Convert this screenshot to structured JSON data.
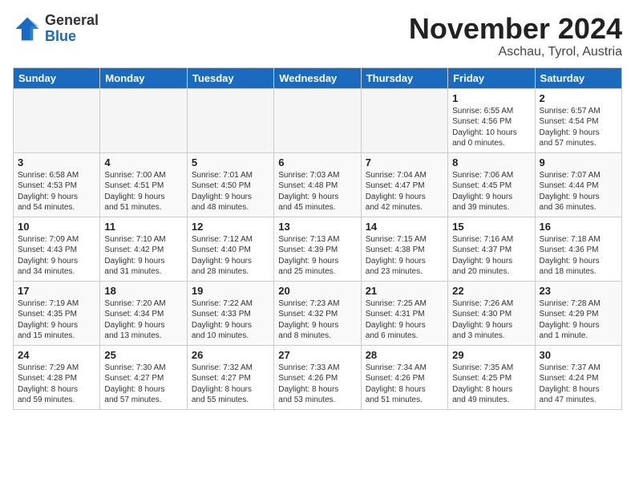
{
  "logo": {
    "general": "General",
    "blue": "Blue"
  },
  "header": {
    "month": "November 2024",
    "location": "Aschau, Tyrol, Austria"
  },
  "weekdays": [
    "Sunday",
    "Monday",
    "Tuesday",
    "Wednesday",
    "Thursday",
    "Friday",
    "Saturday"
  ],
  "weeks": [
    [
      {
        "day": "",
        "info": ""
      },
      {
        "day": "",
        "info": ""
      },
      {
        "day": "",
        "info": ""
      },
      {
        "day": "",
        "info": ""
      },
      {
        "day": "",
        "info": ""
      },
      {
        "day": "1",
        "info": "Sunrise: 6:55 AM\nSunset: 4:56 PM\nDaylight: 10 hours\nand 0 minutes."
      },
      {
        "day": "2",
        "info": "Sunrise: 6:57 AM\nSunset: 4:54 PM\nDaylight: 9 hours\nand 57 minutes."
      }
    ],
    [
      {
        "day": "3",
        "info": "Sunrise: 6:58 AM\nSunset: 4:53 PM\nDaylight: 9 hours\nand 54 minutes."
      },
      {
        "day": "4",
        "info": "Sunrise: 7:00 AM\nSunset: 4:51 PM\nDaylight: 9 hours\nand 51 minutes."
      },
      {
        "day": "5",
        "info": "Sunrise: 7:01 AM\nSunset: 4:50 PM\nDaylight: 9 hours\nand 48 minutes."
      },
      {
        "day": "6",
        "info": "Sunrise: 7:03 AM\nSunset: 4:48 PM\nDaylight: 9 hours\nand 45 minutes."
      },
      {
        "day": "7",
        "info": "Sunrise: 7:04 AM\nSunset: 4:47 PM\nDaylight: 9 hours\nand 42 minutes."
      },
      {
        "day": "8",
        "info": "Sunrise: 7:06 AM\nSunset: 4:45 PM\nDaylight: 9 hours\nand 39 minutes."
      },
      {
        "day": "9",
        "info": "Sunrise: 7:07 AM\nSunset: 4:44 PM\nDaylight: 9 hours\nand 36 minutes."
      }
    ],
    [
      {
        "day": "10",
        "info": "Sunrise: 7:09 AM\nSunset: 4:43 PM\nDaylight: 9 hours\nand 34 minutes."
      },
      {
        "day": "11",
        "info": "Sunrise: 7:10 AM\nSunset: 4:42 PM\nDaylight: 9 hours\nand 31 minutes."
      },
      {
        "day": "12",
        "info": "Sunrise: 7:12 AM\nSunset: 4:40 PM\nDaylight: 9 hours\nand 28 minutes."
      },
      {
        "day": "13",
        "info": "Sunrise: 7:13 AM\nSunset: 4:39 PM\nDaylight: 9 hours\nand 25 minutes."
      },
      {
        "day": "14",
        "info": "Sunrise: 7:15 AM\nSunset: 4:38 PM\nDaylight: 9 hours\nand 23 minutes."
      },
      {
        "day": "15",
        "info": "Sunrise: 7:16 AM\nSunset: 4:37 PM\nDaylight: 9 hours\nand 20 minutes."
      },
      {
        "day": "16",
        "info": "Sunrise: 7:18 AM\nSunset: 4:36 PM\nDaylight: 9 hours\nand 18 minutes."
      }
    ],
    [
      {
        "day": "17",
        "info": "Sunrise: 7:19 AM\nSunset: 4:35 PM\nDaylight: 9 hours\nand 15 minutes."
      },
      {
        "day": "18",
        "info": "Sunrise: 7:20 AM\nSunset: 4:34 PM\nDaylight: 9 hours\nand 13 minutes."
      },
      {
        "day": "19",
        "info": "Sunrise: 7:22 AM\nSunset: 4:33 PM\nDaylight: 9 hours\nand 10 minutes."
      },
      {
        "day": "20",
        "info": "Sunrise: 7:23 AM\nSunset: 4:32 PM\nDaylight: 9 hours\nand 8 minutes."
      },
      {
        "day": "21",
        "info": "Sunrise: 7:25 AM\nSunset: 4:31 PM\nDaylight: 9 hours\nand 6 minutes."
      },
      {
        "day": "22",
        "info": "Sunrise: 7:26 AM\nSunset: 4:30 PM\nDaylight: 9 hours\nand 3 minutes."
      },
      {
        "day": "23",
        "info": "Sunrise: 7:28 AM\nSunset: 4:29 PM\nDaylight: 9 hours\nand 1 minute."
      }
    ],
    [
      {
        "day": "24",
        "info": "Sunrise: 7:29 AM\nSunset: 4:28 PM\nDaylight: 8 hours\nand 59 minutes."
      },
      {
        "day": "25",
        "info": "Sunrise: 7:30 AM\nSunset: 4:27 PM\nDaylight: 8 hours\nand 57 minutes."
      },
      {
        "day": "26",
        "info": "Sunrise: 7:32 AM\nSunset: 4:27 PM\nDaylight: 8 hours\nand 55 minutes."
      },
      {
        "day": "27",
        "info": "Sunrise: 7:33 AM\nSunset: 4:26 PM\nDaylight: 8 hours\nand 53 minutes."
      },
      {
        "day": "28",
        "info": "Sunrise: 7:34 AM\nSunset: 4:26 PM\nDaylight: 8 hours\nand 51 minutes."
      },
      {
        "day": "29",
        "info": "Sunrise: 7:35 AM\nSunset: 4:25 PM\nDaylight: 8 hours\nand 49 minutes."
      },
      {
        "day": "30",
        "info": "Sunrise: 7:37 AM\nSunset: 4:24 PM\nDaylight: 8 hours\nand 47 minutes."
      }
    ]
  ]
}
